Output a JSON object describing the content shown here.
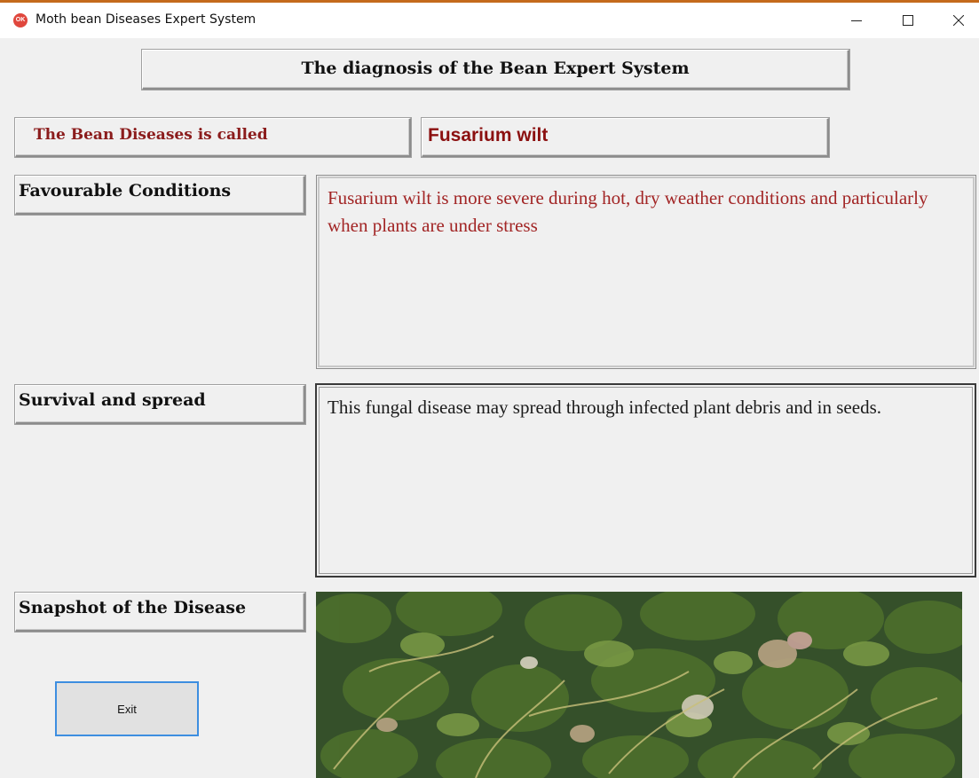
{
  "window": {
    "title": "Moth bean Diseases Expert System",
    "icon_text": "OK"
  },
  "header": {
    "title": "The diagnosis of the Bean Expert System"
  },
  "disease": {
    "called_label": "The Bean Diseases is called",
    "name": "Fusarium wilt"
  },
  "favourable": {
    "label": "Favourable Conditions",
    "text": "Fusarium wilt is more severe during hot, dry weather conditions and particularly when plants are under stress"
  },
  "survival": {
    "label": "Survival and spread",
    "text": "This fungal disease may spread through infected plant debris and in seeds."
  },
  "snapshot": {
    "label": "Snapshot of the Disease"
  },
  "buttons": {
    "exit_label": "Exit"
  },
  "colors": {
    "accent_border": "#3d8ee0",
    "disease_name": "#8b1010",
    "favourable_text": "#a22525",
    "window_frame_top": "#c46a1c"
  },
  "icons": {
    "app": "app-icon",
    "minimize": "minimize-icon",
    "maximize": "maximize-icon",
    "close": "close-icon"
  }
}
